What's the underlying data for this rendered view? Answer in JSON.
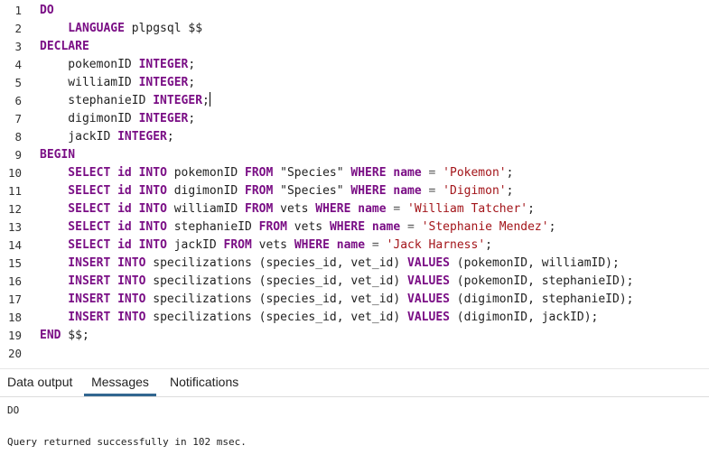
{
  "editor": {
    "lines": [
      {
        "num": "1",
        "tokens": [
          {
            "t": "DO",
            "c": "kw"
          }
        ]
      },
      {
        "num": "2",
        "tokens": [
          {
            "t": "    LANGUAGE",
            "c": "kw"
          },
          {
            "t": " plpgsql $$",
            "c": "plain"
          }
        ]
      },
      {
        "num": "3",
        "tokens": [
          {
            "t": "DECLARE",
            "c": "kw"
          }
        ]
      },
      {
        "num": "4",
        "tokens": [
          {
            "t": "    pokemonID ",
            "c": "plain"
          },
          {
            "t": "INTEGER",
            "c": "kw"
          },
          {
            "t": ";",
            "c": "plain"
          }
        ]
      },
      {
        "num": "5",
        "tokens": [
          {
            "t": "    williamID ",
            "c": "plain"
          },
          {
            "t": "INTEGER",
            "c": "kw"
          },
          {
            "t": ";",
            "c": "plain"
          }
        ]
      },
      {
        "num": "6",
        "tokens": [
          {
            "t": "    stephanieID ",
            "c": "plain"
          },
          {
            "t": "INTEGER",
            "c": "kw"
          },
          {
            "t": ";",
            "c": "plain"
          }
        ],
        "cursor": true
      },
      {
        "num": "7",
        "tokens": [
          {
            "t": "    digimonID ",
            "c": "plain"
          },
          {
            "t": "INTEGER",
            "c": "kw"
          },
          {
            "t": ";",
            "c": "plain"
          }
        ]
      },
      {
        "num": "8",
        "tokens": [
          {
            "t": "    jackID ",
            "c": "plain"
          },
          {
            "t": "INTEGER",
            "c": "kw"
          },
          {
            "t": ";",
            "c": "plain"
          }
        ]
      },
      {
        "num": "9",
        "tokens": [
          {
            "t": "BEGIN",
            "c": "kw"
          }
        ]
      },
      {
        "num": "10",
        "tokens": [
          {
            "t": "    SELECT",
            "c": "kw"
          },
          {
            "t": " ",
            "c": "plain"
          },
          {
            "t": "id",
            "c": "kw"
          },
          {
            "t": " ",
            "c": "plain"
          },
          {
            "t": "INTO",
            "c": "kw"
          },
          {
            "t": " pokemonID ",
            "c": "plain"
          },
          {
            "t": "FROM",
            "c": "kw"
          },
          {
            "t": " \"Species\" ",
            "c": "plain"
          },
          {
            "t": "WHERE",
            "c": "kw"
          },
          {
            "t": " ",
            "c": "plain"
          },
          {
            "t": "name",
            "c": "kw"
          },
          {
            "t": " = ",
            "c": "op"
          },
          {
            "t": "'Pokemon'",
            "c": "str"
          },
          {
            "t": ";",
            "c": "plain"
          }
        ]
      },
      {
        "num": "11",
        "tokens": [
          {
            "t": "    SELECT",
            "c": "kw"
          },
          {
            "t": " ",
            "c": "plain"
          },
          {
            "t": "id",
            "c": "kw"
          },
          {
            "t": " ",
            "c": "plain"
          },
          {
            "t": "INTO",
            "c": "kw"
          },
          {
            "t": " digimonID ",
            "c": "plain"
          },
          {
            "t": "FROM",
            "c": "kw"
          },
          {
            "t": " \"Species\" ",
            "c": "plain"
          },
          {
            "t": "WHERE",
            "c": "kw"
          },
          {
            "t": " ",
            "c": "plain"
          },
          {
            "t": "name",
            "c": "kw"
          },
          {
            "t": " = ",
            "c": "op"
          },
          {
            "t": "'Digimon'",
            "c": "str"
          },
          {
            "t": ";",
            "c": "plain"
          }
        ]
      },
      {
        "num": "12",
        "tokens": [
          {
            "t": "    SELECT",
            "c": "kw"
          },
          {
            "t": " ",
            "c": "plain"
          },
          {
            "t": "id",
            "c": "kw"
          },
          {
            "t": " ",
            "c": "plain"
          },
          {
            "t": "INTO",
            "c": "kw"
          },
          {
            "t": " williamID ",
            "c": "plain"
          },
          {
            "t": "FROM",
            "c": "kw"
          },
          {
            "t": " vets ",
            "c": "plain"
          },
          {
            "t": "WHERE",
            "c": "kw"
          },
          {
            "t": " ",
            "c": "plain"
          },
          {
            "t": "name",
            "c": "kw"
          },
          {
            "t": " = ",
            "c": "op"
          },
          {
            "t": "'William Tatcher'",
            "c": "str"
          },
          {
            "t": ";",
            "c": "plain"
          }
        ]
      },
      {
        "num": "13",
        "tokens": [
          {
            "t": "    SELECT",
            "c": "kw"
          },
          {
            "t": " ",
            "c": "plain"
          },
          {
            "t": "id",
            "c": "kw"
          },
          {
            "t": " ",
            "c": "plain"
          },
          {
            "t": "INTO",
            "c": "kw"
          },
          {
            "t": " stephanieID ",
            "c": "plain"
          },
          {
            "t": "FROM",
            "c": "kw"
          },
          {
            "t": " vets ",
            "c": "plain"
          },
          {
            "t": "WHERE",
            "c": "kw"
          },
          {
            "t": " ",
            "c": "plain"
          },
          {
            "t": "name",
            "c": "kw"
          },
          {
            "t": " = ",
            "c": "op"
          },
          {
            "t": "'Stephanie Mendez'",
            "c": "str"
          },
          {
            "t": ";",
            "c": "plain"
          }
        ]
      },
      {
        "num": "14",
        "tokens": [
          {
            "t": "    SELECT",
            "c": "kw"
          },
          {
            "t": " ",
            "c": "plain"
          },
          {
            "t": "id",
            "c": "kw"
          },
          {
            "t": " ",
            "c": "plain"
          },
          {
            "t": "INTO",
            "c": "kw"
          },
          {
            "t": " jackID ",
            "c": "plain"
          },
          {
            "t": "FROM",
            "c": "kw"
          },
          {
            "t": " vets ",
            "c": "plain"
          },
          {
            "t": "WHERE",
            "c": "kw"
          },
          {
            "t": " ",
            "c": "plain"
          },
          {
            "t": "name",
            "c": "kw"
          },
          {
            "t": " = ",
            "c": "op"
          },
          {
            "t": "'Jack Harness'",
            "c": "str"
          },
          {
            "t": ";",
            "c": "plain"
          }
        ]
      },
      {
        "num": "15",
        "tokens": [
          {
            "t": "    INSERT",
            "c": "kw"
          },
          {
            "t": " ",
            "c": "plain"
          },
          {
            "t": "INTO",
            "c": "kw"
          },
          {
            "t": " specilizations (species_id, vet_id) ",
            "c": "plain"
          },
          {
            "t": "VALUES",
            "c": "kw"
          },
          {
            "t": " (pokemonID, williamID);",
            "c": "plain"
          }
        ]
      },
      {
        "num": "16",
        "tokens": [
          {
            "t": "    INSERT",
            "c": "kw"
          },
          {
            "t": " ",
            "c": "plain"
          },
          {
            "t": "INTO",
            "c": "kw"
          },
          {
            "t": " specilizations (species_id, vet_id) ",
            "c": "plain"
          },
          {
            "t": "VALUES",
            "c": "kw"
          },
          {
            "t": " (pokemonID, stephanieID);",
            "c": "plain"
          }
        ]
      },
      {
        "num": "17",
        "tokens": [
          {
            "t": "    INSERT",
            "c": "kw"
          },
          {
            "t": " ",
            "c": "plain"
          },
          {
            "t": "INTO",
            "c": "kw"
          },
          {
            "t": " specilizations (species_id, vet_id) ",
            "c": "plain"
          },
          {
            "t": "VALUES",
            "c": "kw"
          },
          {
            "t": " (digimonID, stephanieID);",
            "c": "plain"
          }
        ]
      },
      {
        "num": "18",
        "tokens": [
          {
            "t": "    INSERT",
            "c": "kw"
          },
          {
            "t": " ",
            "c": "plain"
          },
          {
            "t": "INTO",
            "c": "kw"
          },
          {
            "t": " specilizations (species_id, vet_id) ",
            "c": "plain"
          },
          {
            "t": "VALUES",
            "c": "kw"
          },
          {
            "t": " (digimonID, jackID);",
            "c": "plain"
          }
        ]
      },
      {
        "num": "19",
        "tokens": [
          {
            "t": "END",
            "c": "kw"
          },
          {
            "t": " $$;",
            "c": "plain"
          }
        ]
      },
      {
        "num": "20",
        "tokens": []
      }
    ]
  },
  "tabs": [
    {
      "label": "Data output",
      "active": false
    },
    {
      "label": "Messages",
      "active": true
    },
    {
      "label": "Notifications",
      "active": false
    }
  ],
  "output": {
    "line1": "DO",
    "line2": "Query returned successfully in 102 msec."
  },
  "colors": {
    "keyword": "#7a0e85",
    "string": "#a3151a",
    "active_tab_underline": "#326690"
  }
}
